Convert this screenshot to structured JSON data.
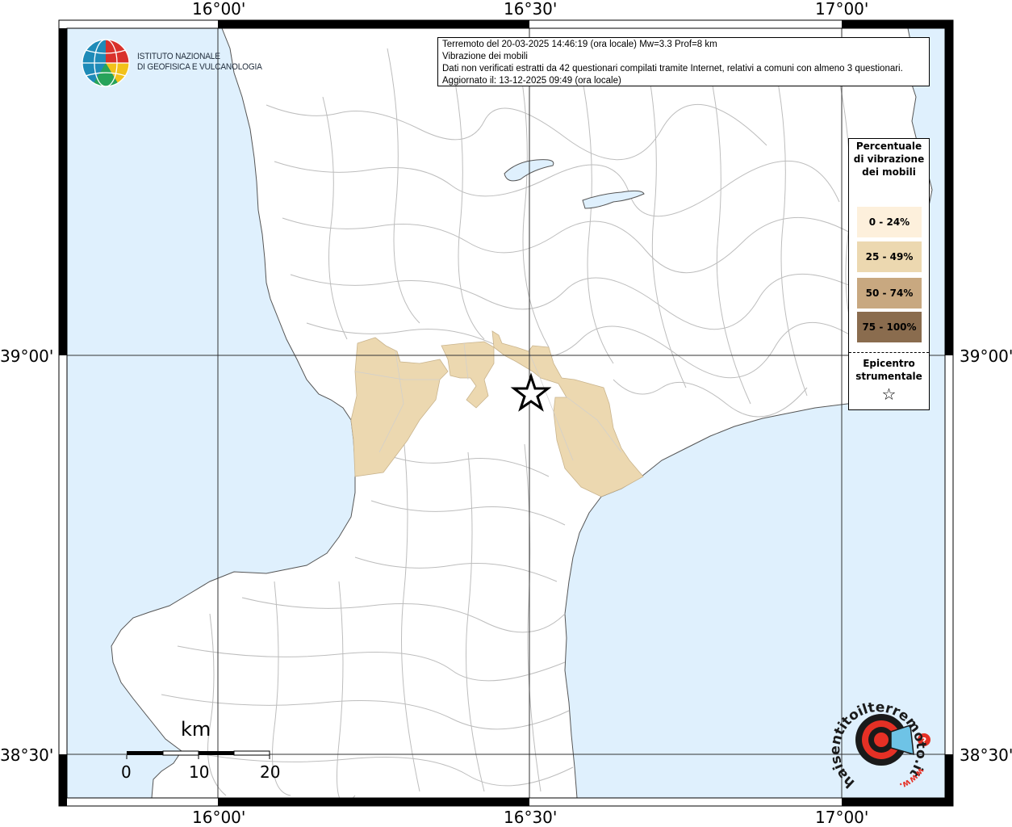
{
  "info": {
    "line1": "Terremoto del 20-03-2025 14:46:19 (ora locale) Mw=3.3 Prof=8 km",
    "line2": "Vibrazione dei mobili",
    "line3": "Dati non verificati estratti da 42 questionari compilati tramite Internet, relativi a comuni con almeno 3 questionari.",
    "line4": "Aggiornato il: 13-12-2025 09:49 (ora locale)"
  },
  "axis": {
    "lon_top": [
      "16°00'",
      "16°30'",
      "17°00'"
    ],
    "lon_bottom": [
      "16°00'",
      "16°30'",
      "17°00'"
    ],
    "lat_left": [
      "39°00'",
      "38°30'"
    ],
    "lat_right": [
      "39°00'",
      "38°30'"
    ]
  },
  "legend": {
    "title": "Percentuale di vibrazione dei mobili",
    "classes": [
      {
        "label": "0 - 24%",
        "color": "#fdf0dc"
      },
      {
        "label": "25 - 49%",
        "color": "#ecd8b0"
      },
      {
        "label": "50 - 74%",
        "color": "#c8a880"
      },
      {
        "label": "75 - 100%",
        "color": "#8a6c4e"
      }
    ],
    "epicenter_label": "Epicentro strumentale"
  },
  "ingv_logo": {
    "line1": "ISTITUTO NAZIONALE",
    "line2": "DI GEOFISICA E VULCANOLOGIA"
  },
  "scale_bar": {
    "unit": "km",
    "ticks": [
      "0",
      "10",
      "20"
    ]
  },
  "hst_logo": {
    "text": "haisentitoilterremoto.it",
    "prefix": "www."
  },
  "colors": {
    "sea": "#dff0fd",
    "land": "#ffffff",
    "affected": "#ecd8b0",
    "rivers": "#bbbbbb"
  },
  "map": {
    "epicenter": {
      "lat": 38.935,
      "lon": 16.5
    },
    "affected_class": "25 - 49%"
  }
}
